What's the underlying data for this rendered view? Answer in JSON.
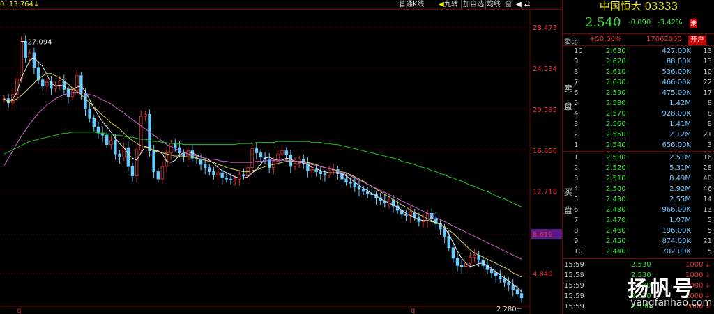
{
  "toolbar": {
    "info": "0: 13.764↓",
    "chart_type": "普通K线",
    "nine_turn": "九转",
    "add_watchlist": "加自选",
    "ma_line": "均线",
    "window": "窗",
    "pin": "◀",
    "arrows": "⇄"
  },
  "chart_data": {
    "type": "line",
    "title": "",
    "y_ticks": [
      "28.473",
      "24.534",
      "20.595",
      "16.656",
      "12.718",
      "8.619",
      "4.840"
    ],
    "y_tick_values": [
      28.473,
      24.534,
      20.595,
      16.656,
      12.718,
      8.619,
      4.84
    ],
    "ylim": [
      2.28,
      30.2
    ],
    "high_label": "27.094",
    "low_label": "2.280",
    "x_markers": [
      "q",
      "q"
    ],
    "price": [
      21.6,
      21.2,
      22.0,
      23.5,
      27.1,
      25.5,
      26.0,
      24.6,
      23.4,
      22.8,
      23.2,
      22.6,
      22.9,
      23.3,
      22.5,
      21.8,
      22.4,
      23.8,
      22.1,
      20.6,
      19.7,
      18.9,
      18.3,
      18.1,
      17.2,
      17.6,
      16.3,
      16.0,
      16.9,
      15.1,
      14.2,
      16.7,
      19.9,
      20.1,
      16.6,
      14.6,
      13.9,
      15.1,
      16.4,
      17.3,
      16.9,
      16.4,
      16.1,
      16.6,
      15.9,
      15.8,
      15.3,
      15.0,
      14.6,
      14.3,
      14.5,
      14.0,
      13.9,
      13.8,
      13.9,
      14.3,
      14.2,
      15.0,
      16.8,
      16.4,
      16.0,
      15.8,
      15.0,
      15.6,
      16.3,
      16.6,
      16.2,
      15.1,
      15.4,
      15.8,
      15.4,
      14.7,
      14.8,
      14.6,
      14.4,
      14.3,
      14.7,
      14.8,
      14.4,
      13.9,
      13.6,
      13.5,
      13.2,
      12.9,
      12.7,
      12.5,
      12.4,
      12.1,
      11.8,
      11.6,
      11.9,
      11.3,
      10.9,
      10.5,
      10.4,
      10.7,
      10.2,
      9.8,
      9.9,
      10.6,
      10.1,
      9.6,
      9.1,
      8.4,
      7.3,
      6.3,
      5.6,
      5.5,
      5.8,
      6.4,
      6.6,
      6.1,
      5.6,
      5.2,
      4.9,
      4.6,
      4.3,
      4.0,
      3.7,
      3.3,
      2.9,
      2.5
    ],
    "series": [
      {
        "color": "#e8e8e8",
        "values": [
          21.6,
          21.3,
          21.6,
          22.2,
          23.6,
          24.4,
          25.3,
          25.5,
          25.1,
          24.7,
          23.9,
          23.1,
          22.8,
          22.9,
          22.8,
          22.5,
          22.5,
          22.7,
          22.8,
          22.3,
          21.5,
          20.7,
          20.0,
          19.4,
          18.9,
          18.4,
          17.8,
          17.3,
          16.9,
          16.3,
          15.9,
          15.7,
          16.4,
          17.0,
          16.9,
          16.6,
          16.6,
          16.3,
          15.6,
          15.5,
          15.7,
          16.2,
          16.4,
          16.5,
          16.4,
          16.2,
          16.0,
          15.9,
          15.7,
          15.4,
          15.0,
          14.7,
          14.5,
          14.3,
          14.1,
          14.0,
          14.0,
          14.1,
          14.5,
          14.8,
          15.3,
          15.9,
          16.0,
          15.8,
          15.7,
          15.7,
          15.9,
          15.8,
          15.6,
          15.5,
          15.5,
          15.3,
          15.0,
          14.9,
          14.7,
          14.6,
          14.5,
          14.5,
          14.5,
          14.4,
          14.2,
          13.9,
          13.6,
          13.3,
          13.0,
          12.8,
          12.5,
          12.3,
          12.0,
          11.8,
          11.6,
          11.4,
          11.2,
          10.9,
          10.6,
          10.4,
          10.2,
          10.0,
          9.9,
          9.9,
          9.8,
          9.7,
          9.6,
          9.2,
          8.6,
          7.8,
          7.0,
          6.3,
          5.8,
          5.5,
          5.6,
          5.8,
          5.8,
          5.6,
          5.3,
          5.0,
          4.7,
          4.4,
          4.1,
          3.8,
          3.5,
          3.1
        ]
      },
      {
        "color": "#d8d060",
        "values": [
          21.5,
          21.4,
          21.4,
          21.6,
          21.9,
          22.3,
          22.7,
          23.1,
          23.5,
          23.8,
          24.0,
          24.0,
          23.8,
          23.6,
          23.3,
          23.0,
          22.6,
          22.3,
          22.0,
          21.6,
          21.2,
          20.8,
          20.4,
          20.0,
          19.7,
          19.3,
          19.0,
          18.7,
          18.3,
          17.9,
          17.6,
          17.3,
          17.1,
          17.0,
          16.8,
          16.6,
          16.5,
          16.4,
          16.3,
          16.2,
          16.1,
          16.1,
          16.1,
          16.0,
          16.0,
          15.9,
          15.8,
          15.7,
          15.6,
          15.5,
          15.3,
          15.2,
          15.0,
          14.9,
          14.8,
          14.7,
          14.6,
          14.6,
          14.7,
          14.8,
          14.9,
          15.1,
          15.2,
          15.3,
          15.4,
          15.5,
          15.6,
          15.6,
          15.6,
          15.6,
          15.6,
          15.5,
          15.4,
          15.3,
          15.1,
          15.0,
          14.9,
          14.8,
          14.7,
          14.6,
          14.5,
          14.3,
          14.1,
          13.9,
          13.7,
          13.4,
          13.2,
          12.9,
          12.7,
          12.4,
          12.2,
          11.9,
          11.7,
          11.4,
          11.2,
          10.9,
          10.7,
          10.5,
          10.3,
          10.1,
          9.9,
          9.7,
          9.5,
          9.3,
          9.0,
          8.7,
          8.3,
          7.9,
          7.5,
          7.1,
          6.8,
          6.6,
          6.4,
          6.2,
          6.0,
          5.8,
          5.6,
          5.4,
          5.2,
          4.9,
          4.7,
          4.5
        ]
      },
      {
        "color": "#d060d0",
        "values": [
          15.2,
          15.9,
          16.6,
          17.3,
          18.0,
          18.6,
          19.2,
          19.7,
          20.2,
          20.6,
          21.0,
          21.3,
          21.6,
          21.8,
          22.0,
          22.1,
          22.2,
          22.2,
          22.2,
          22.1,
          22.0,
          21.9,
          21.7,
          21.5,
          21.3,
          21.1,
          20.8,
          20.5,
          20.2,
          19.9,
          19.6,
          19.3,
          19.0,
          18.7,
          18.4,
          18.1,
          17.8,
          17.5,
          17.2,
          17.0,
          16.8,
          16.6,
          16.4,
          16.3,
          16.2,
          16.1,
          16.0,
          15.9,
          15.8,
          15.8,
          15.7,
          15.6,
          15.6,
          15.5,
          15.5,
          15.5,
          15.5,
          15.5,
          15.5,
          15.6,
          15.6,
          15.6,
          15.7,
          15.7,
          15.7,
          15.7,
          15.7,
          15.7,
          15.6,
          15.6,
          15.5,
          15.4,
          15.3,
          15.2,
          15.1,
          15.0,
          14.9,
          14.8,
          14.6,
          14.5,
          14.3,
          14.2,
          14.0,
          13.8,
          13.6,
          13.4,
          13.2,
          13.0,
          12.8,
          12.6,
          12.4,
          12.2,
          12.0,
          11.8,
          11.6,
          11.4,
          11.2,
          11.0,
          10.8,
          10.6,
          10.4,
          10.2,
          10.0,
          9.8,
          9.6,
          9.4,
          9.2,
          9.0,
          8.8,
          8.6,
          8.4,
          8.2,
          8.0,
          7.8,
          7.6,
          7.4,
          7.2,
          7.0,
          6.8,
          6.6,
          6.4,
          6.2
        ]
      },
      {
        "color": "#20c020",
        "values": [
          16.3,
          16.5,
          16.7,
          16.9,
          17.1,
          17.3,
          17.5,
          17.6,
          17.7,
          17.8,
          17.9,
          18.0,
          18.1,
          18.2,
          18.3,
          18.3,
          18.4,
          18.4,
          18.4,
          18.4,
          18.4,
          18.4,
          18.3,
          18.3,
          18.2,
          18.2,
          18.1,
          18.1,
          18.0,
          17.9,
          17.9,
          17.8,
          17.7,
          17.7,
          17.6,
          17.5,
          17.5,
          17.4,
          17.4,
          17.3,
          17.3,
          17.3,
          17.2,
          17.2,
          17.2,
          17.2,
          17.2,
          17.2,
          17.2,
          17.2,
          17.2,
          17.2,
          17.2,
          17.2,
          17.2,
          17.3,
          17.3,
          17.3,
          17.3,
          17.4,
          17.4,
          17.4,
          17.4,
          17.4,
          17.5,
          17.5,
          17.5,
          17.5,
          17.5,
          17.5,
          17.5,
          17.5,
          17.4,
          17.4,
          17.4,
          17.3,
          17.3,
          17.2,
          17.2,
          17.1,
          17.0,
          16.9,
          16.8,
          16.7,
          16.6,
          16.5,
          16.4,
          16.3,
          16.2,
          16.1,
          16.0,
          15.9,
          15.8,
          15.6,
          15.5,
          15.4,
          15.3,
          15.1,
          15.0,
          14.9,
          14.7,
          14.6,
          14.4,
          14.3,
          14.1,
          14.0,
          13.8,
          13.7,
          13.5,
          13.3,
          13.2,
          13.0,
          12.8,
          12.7,
          12.5,
          12.3,
          12.1,
          12.0,
          11.8,
          11.6,
          11.4,
          11.2
        ]
      }
    ],
    "current_marker": "8.619"
  },
  "panel": {
    "title": "中国恒大 03333",
    "price": "2.540",
    "change": "-0.090",
    "change_pct": "-3.42%",
    "market_badge": "港",
    "weibi_label": "委比",
    "weibi_value": "+50.00%",
    "weicha_value": "17062000",
    "open_account": "开户",
    "sell_label_1": "卖",
    "sell_label_2": "盘",
    "buy_label_1": "买",
    "buy_label_2": "盘",
    "asks": [
      {
        "level": "10",
        "price": "2.630",
        "vol": "427.00K",
        "n": "13"
      },
      {
        "level": "9",
        "price": "2.620",
        "vol": "88.00K",
        "n": "13"
      },
      {
        "level": "8",
        "price": "2.610",
        "vol": "536.00K",
        "n": "10"
      },
      {
        "level": "7",
        "price": "2.600",
        "vol": "466.00K",
        "n": "22"
      },
      {
        "level": "6",
        "price": "2.590",
        "vol": "475.00K",
        "n": "17"
      },
      {
        "level": "5",
        "price": "2.580",
        "vol": "1.42M",
        "n": "8"
      },
      {
        "level": "4",
        "price": "2.570",
        "vol": "928.00K",
        "n": "8"
      },
      {
        "level": "3",
        "price": "2.560",
        "vol": "1.41M",
        "n": "8"
      },
      {
        "level": "2",
        "price": "2.550",
        "vol": "2.12M",
        "n": "21"
      },
      {
        "level": "1",
        "price": "2.540",
        "vol": "656.00K",
        "n": "3"
      }
    ],
    "bids": [
      {
        "level": "1",
        "price": "2.530",
        "vol": "2.51M",
        "n": "16"
      },
      {
        "level": "2",
        "price": "2.520",
        "vol": "5.31M",
        "n": "28"
      },
      {
        "level": "3",
        "price": "2.510",
        "vol": "8.49M",
        "n": "40"
      },
      {
        "level": "4",
        "price": "2.500",
        "vol": "2.92M",
        "n": "46"
      },
      {
        "level": "5",
        "price": "2.490",
        "vol": "2.55M",
        "n": "14"
      },
      {
        "level": "6",
        "price": "2.480",
        "vol": "966.00K",
        "n": "13"
      },
      {
        "level": "7",
        "price": "2.470",
        "vol": "1.07M",
        "n": "5"
      },
      {
        "level": "8",
        "price": "2.460",
        "vol": "196.00K",
        "n": "5"
      },
      {
        "level": "9",
        "price": "2.450",
        "vol": "874.00K",
        "n": "21"
      },
      {
        "level": "10",
        "price": "2.440",
        "vol": "702.00K",
        "n": "5"
      }
    ],
    "ticks": [
      {
        "time": "15:59",
        "price": "2.530",
        "vol": "1000",
        "arrow": "↓"
      },
      {
        "time": "15:59",
        "price": "2.530",
        "vol": "1000",
        "arrow": "↓"
      },
      {
        "time": "15:59",
        "price": "2.530",
        "vol": "1000",
        "arrow": "↓"
      },
      {
        "time": "15:59",
        "price": "2.530",
        "vol": "1000",
        "arrow": "↓"
      },
      {
        "time": "15:59",
        "price": "2.530",
        "vol": "1000",
        "arrow": "↓"
      }
    ]
  },
  "watermark": {
    "cn": "扬帆号",
    "en": "yangfanhao.com"
  },
  "colors": {
    "up": "#e33333",
    "down": "#2ee62e",
    "candle_down": "#66ccff",
    "grid": "#7a0000"
  }
}
